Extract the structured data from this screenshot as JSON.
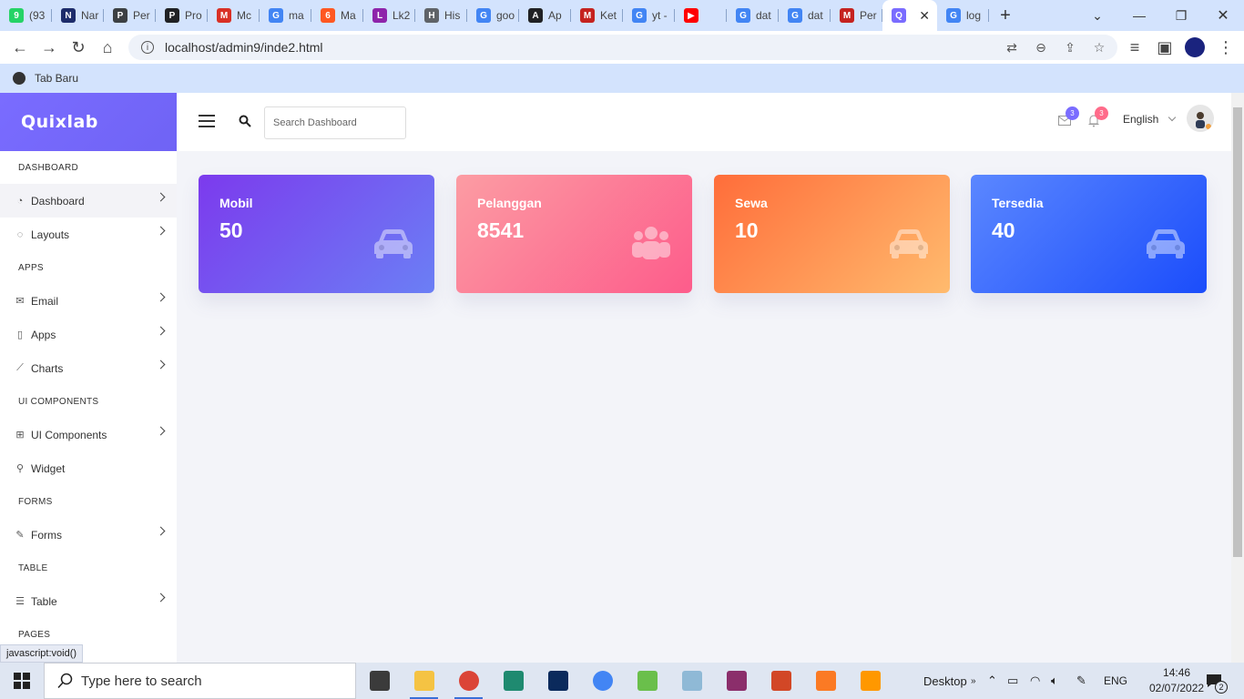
{
  "browser": {
    "tabs": [
      {
        "title": "(93",
        "fav_color": "#25d366",
        "glyph": "9"
      },
      {
        "title": "Nar",
        "fav_color": "#1d2c6b",
        "glyph": "N"
      },
      {
        "title": "Per",
        "fav_color": "#3c4043",
        "glyph": "P"
      },
      {
        "title": "Pro",
        "fav_color": "#202124",
        "glyph": "P"
      },
      {
        "title": "Mc",
        "fav_color": "#d93025",
        "glyph": "M"
      },
      {
        "title": "ma",
        "fav_color": "#4285f4",
        "glyph": "G"
      },
      {
        "title": "Ma",
        "fav_color": "#ff5722",
        "glyph": "6"
      },
      {
        "title": "Lk2",
        "fav_color": "#8e24aa",
        "glyph": "L"
      },
      {
        "title": "His",
        "fav_color": "#5f6368",
        "glyph": "H"
      },
      {
        "title": "goo",
        "fav_color": "#4285f4",
        "glyph": "G"
      },
      {
        "title": "Ap",
        "fav_color": "#202124",
        "glyph": "A"
      },
      {
        "title": "Ket",
        "fav_color": "#c5221f",
        "glyph": "M"
      },
      {
        "title": "yt -",
        "fav_color": "#4285f4",
        "glyph": "G"
      },
      {
        "title": "",
        "fav_color": "#ff0000",
        "glyph": "▶"
      },
      {
        "title": "dat",
        "fav_color": "#4285f4",
        "glyph": "G"
      },
      {
        "title": "dat",
        "fav_color": "#4285f4",
        "glyph": "G"
      },
      {
        "title": "Per",
        "fav_color": "#c5221f",
        "glyph": "M"
      },
      {
        "title": "",
        "fav_color": "#7a6cff",
        "glyph": "Q",
        "active": true
      },
      {
        "title": "log",
        "fav_color": "#4285f4",
        "glyph": "G"
      }
    ],
    "url": "localhost/admin9/inde2.html",
    "bookmark": "Tab Baru",
    "status_url": "javascript:void()"
  },
  "sidebar": {
    "brand": "Quixlab",
    "items": [
      {
        "type": "section",
        "label": "DASHBOARD"
      },
      {
        "type": "menu",
        "label": "Dashboard",
        "icon": "speedometer-icon",
        "glyph": "◔",
        "active": true,
        "chevron": true
      },
      {
        "type": "menu",
        "label": "Layouts",
        "icon": "globe-icon",
        "glyph": "◌",
        "chevron": true
      },
      {
        "type": "section",
        "label": "APPS"
      },
      {
        "type": "menu",
        "label": "Email",
        "icon": "envelope-icon",
        "glyph": "✉",
        "chevron": true
      },
      {
        "type": "menu",
        "label": "Apps",
        "icon": "notebook-icon",
        "glyph": "▯",
        "chevron": true
      },
      {
        "type": "menu",
        "label": "Charts",
        "icon": "graph-icon",
        "glyph": "⟋",
        "chevron": true
      },
      {
        "type": "section",
        "label": "UI COMPONENTS"
      },
      {
        "type": "menu",
        "label": "UI Components",
        "icon": "grid-icon",
        "glyph": "⊞",
        "chevron": true
      },
      {
        "type": "menu",
        "label": "Widget",
        "icon": "badge-icon",
        "glyph": "⚲",
        "chevron": false
      },
      {
        "type": "section",
        "label": "FORMS"
      },
      {
        "type": "menu",
        "label": "Forms",
        "icon": "note-icon",
        "glyph": "✎",
        "chevron": true
      },
      {
        "type": "section",
        "label": "TABLE"
      },
      {
        "type": "menu",
        "label": "Table",
        "icon": "menu-icon",
        "glyph": "☰",
        "chevron": true
      },
      {
        "type": "section",
        "label": "PAGES"
      }
    ]
  },
  "header": {
    "search_placeholder": "Search Dashboard",
    "mail_badge": "3",
    "notif_badge": "3",
    "language": "English"
  },
  "cards": [
    {
      "label": "Mobil",
      "value": "50",
      "icon": "car-icon",
      "gradient": [
        "#7c3aed",
        "#6b7ff5"
      ]
    },
    {
      "label": "Pelanggan",
      "value": "8541",
      "icon": "users-icon",
      "gradient": [
        "#fc9ca3",
        "#fd5c8b"
      ]
    },
    {
      "label": "Sewa",
      "value": "10",
      "icon": "car-icon",
      "gradient": [
        "#ff6d3a",
        "#ffbb6e"
      ]
    },
    {
      "label": "Tersedia",
      "value": "40",
      "icon": "car-icon",
      "gradient": [
        "#5b87ff",
        "#1b4dfb"
      ]
    }
  ],
  "taskbar": {
    "search_placeholder": "Type here to search",
    "apps": [
      {
        "name": "task-view",
        "color": "#3b3b3b",
        "on": false
      },
      {
        "name": "file-explorer",
        "color": "#f5c343",
        "on": true
      },
      {
        "name": "chrome-profile",
        "color": "#db4437",
        "on": true
      },
      {
        "name": "filmora",
        "color": "#1f8a70",
        "on": false
      },
      {
        "name": "photoshop",
        "color": "#0b2a5c",
        "on": false
      },
      {
        "name": "chrome",
        "color": "#4285f4",
        "on": false
      },
      {
        "name": "coreldraw",
        "color": "#6abf4b",
        "on": false
      },
      {
        "name": "notepad",
        "color": "#8fb9d6",
        "on": false
      },
      {
        "name": "winrar",
        "color": "#8b2e6b",
        "on": false
      },
      {
        "name": "powerpoint",
        "color": "#d24726",
        "on": false
      },
      {
        "name": "xampp",
        "color": "#fb7a24",
        "on": false
      },
      {
        "name": "sublime-text",
        "color": "#ff9800",
        "on": false
      }
    ],
    "desktop_label": "Desktop",
    "lang": "ENG",
    "time": "14:46",
    "date": "02/07/2022",
    "notif_count": "2"
  }
}
